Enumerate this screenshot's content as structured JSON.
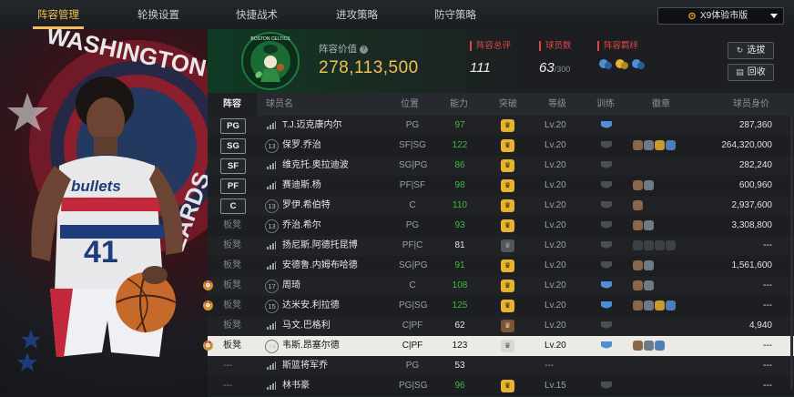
{
  "tabs": [
    {
      "label": "阵容管理",
      "active": true
    },
    {
      "label": "轮换设置",
      "active": false
    },
    {
      "label": "快捷战术",
      "active": false
    },
    {
      "label": "进攻策略",
      "active": false
    },
    {
      "label": "防守策略",
      "active": false
    }
  ],
  "version": {
    "label": "X9体验市版"
  },
  "art": {
    "logo_text": "WASHINGTON",
    "jersey_text": "bullets",
    "jersey_number": "41",
    "right_text": "ZARDS"
  },
  "header": {
    "team_logo": {
      "text": "BOSTON CELTICS"
    },
    "value_label": "阵容价值",
    "value": "278,113,500",
    "rating_label": "阵容总评",
    "rating": "111",
    "count_label": "球员数",
    "count": "63",
    "count_max": "/300",
    "bond_label": "阵容羁绊",
    "select_label": "选拔",
    "recycle_label": "回收"
  },
  "columns": [
    "阵容",
    "球员名",
    "位置",
    "能力",
    "突破",
    "等级",
    "训练",
    "徽章",
    "球员身价"
  ],
  "accent": "#f0c24a",
  "rows": [
    {
      "pos": "PG",
      "num": "",
      "name": "T.J.迈克康内尔",
      "position": "PG",
      "ability": "97",
      "ability_color": "g",
      "bt": "gold",
      "level": "Lv.20",
      "train": "blue",
      "train_label": "5",
      "badges": [],
      "salary": "287,360",
      "bell": false,
      "sel": false
    },
    {
      "pos": "SG",
      "num": "13",
      "name": "保罗.乔治",
      "position": "SF|SG",
      "ability": "122",
      "ability_color": "g",
      "bt": "gold",
      "level": "Lv.20",
      "train": "gray",
      "train_label": "",
      "badges": [
        "br",
        "sv",
        "gd",
        "bl"
      ],
      "salary": "264,320,000",
      "bell": false,
      "sel": false
    },
    {
      "pos": "SF",
      "num": "",
      "name": "维克托.奥拉迪波",
      "position": "SG|PG",
      "ability": "86",
      "ability_color": "g",
      "bt": "gold",
      "level": "Lv.20",
      "train": "gray",
      "train_label": "",
      "badges": [],
      "salary": "282,240",
      "bell": false,
      "sel": false
    },
    {
      "pos": "PF",
      "num": "",
      "name": "赛迪斯.杨",
      "position": "PF|SF",
      "ability": "98",
      "ability_color": "g",
      "bt": "gold",
      "level": "Lv.20",
      "train": "gray",
      "train_label": "",
      "badges": [
        "br",
        "sv"
      ],
      "salary": "600,960",
      "bell": false,
      "sel": false
    },
    {
      "pos": "C",
      "num": "13",
      "name": "罗伊.希伯特",
      "position": "C",
      "ability": "110",
      "ability_color": "g",
      "bt": "gold",
      "level": "Lv.20",
      "train": "gray",
      "train_label": "",
      "badges": [
        "br"
      ],
      "salary": "2,937,600",
      "bell": false,
      "sel": false
    },
    {
      "pos": "",
      "bench": "板凳",
      "num": "13",
      "name": "乔治.希尔",
      "position": "PG",
      "ability": "93",
      "ability_color": "g",
      "bt": "gold",
      "level": "Lv.20",
      "train": "gray",
      "train_label": "",
      "badges": [
        "br",
        "sv"
      ],
      "salary": "3,308,800",
      "bell": false,
      "sel": false
    },
    {
      "pos": "",
      "bench": "板凳",
      "num": "",
      "name": "扬尼斯.阿德托昆博",
      "position": "PF|C",
      "ability": "81",
      "ability_color": "w",
      "bt": "gray",
      "level": "Lv.20",
      "train": "gray",
      "train_label": "",
      "badges": [
        "dk",
        "dk",
        "dk",
        "dk"
      ],
      "salary": "---",
      "bell": false,
      "sel": false
    },
    {
      "pos": "",
      "bench": "板凳",
      "num": "",
      "name": "安德鲁.内姆布哈德",
      "position": "SG|PG",
      "ability": "91",
      "ability_color": "g",
      "bt": "gold",
      "level": "Lv.20",
      "train": "gray",
      "train_label": "",
      "badges": [
        "br",
        "sv"
      ],
      "salary": "1,561,600",
      "bell": false,
      "sel": false
    },
    {
      "pos": "",
      "bench": "板凳",
      "num": "17",
      "name": "周琦",
      "position": "C",
      "ability": "108",
      "ability_color": "g",
      "bt": "gold",
      "level": "Lv.20",
      "train": "blue",
      "train_label": "",
      "badges": [
        "br",
        "sv"
      ],
      "salary": "---",
      "bell": true,
      "sel": false
    },
    {
      "pos": "",
      "bench": "板凳",
      "num": "15",
      "name": "达米安.利拉德",
      "position": "PG|SG",
      "ability": "125",
      "ability_color": "g",
      "bt": "gold",
      "level": "Lv.20",
      "train": "blue",
      "train_label": "",
      "badges": [
        "br",
        "sv",
        "gd",
        "bl"
      ],
      "salary": "---",
      "bell": true,
      "sel": false
    },
    {
      "pos": "",
      "bench": "板凳",
      "num": "",
      "name": "马文.巴格利",
      "position": "C|PF",
      "ability": "62",
      "ability_color": "w",
      "bt": "brown",
      "level": "Lv.20",
      "train": "gray",
      "train_label": "",
      "badges": [],
      "salary": "4,940",
      "bell": false,
      "sel": false
    },
    {
      "pos": "",
      "bench": "板凳",
      "num": "74",
      "name": "韦斯.昂塞尔德",
      "position": "C|PF",
      "ability": "123",
      "ability_color": "w",
      "bt": "grayw",
      "level": "Lv.20",
      "train": "blue",
      "train_label": "",
      "badges": [
        "br",
        "sv",
        "bl"
      ],
      "salary": "---",
      "bell": true,
      "sel": true
    },
    {
      "pos": "",
      "bench": "---",
      "num": "",
      "name": "斯篮将军乔",
      "position": "PG",
      "ability": "53",
      "ability_color": "w",
      "bt": "none",
      "level": "---",
      "train": "none",
      "train_label": "",
      "badges": [],
      "salary": "---",
      "bell": false,
      "sel": false
    },
    {
      "pos": "",
      "bench": "---",
      "num": "",
      "name": "林书豪",
      "position": "PG|SG",
      "ability": "96",
      "ability_color": "g",
      "bt": "gold",
      "level": "Lv.15",
      "train": "gray",
      "train_label": "",
      "badges": [],
      "salary": "---",
      "bell": false,
      "sel": false
    }
  ]
}
